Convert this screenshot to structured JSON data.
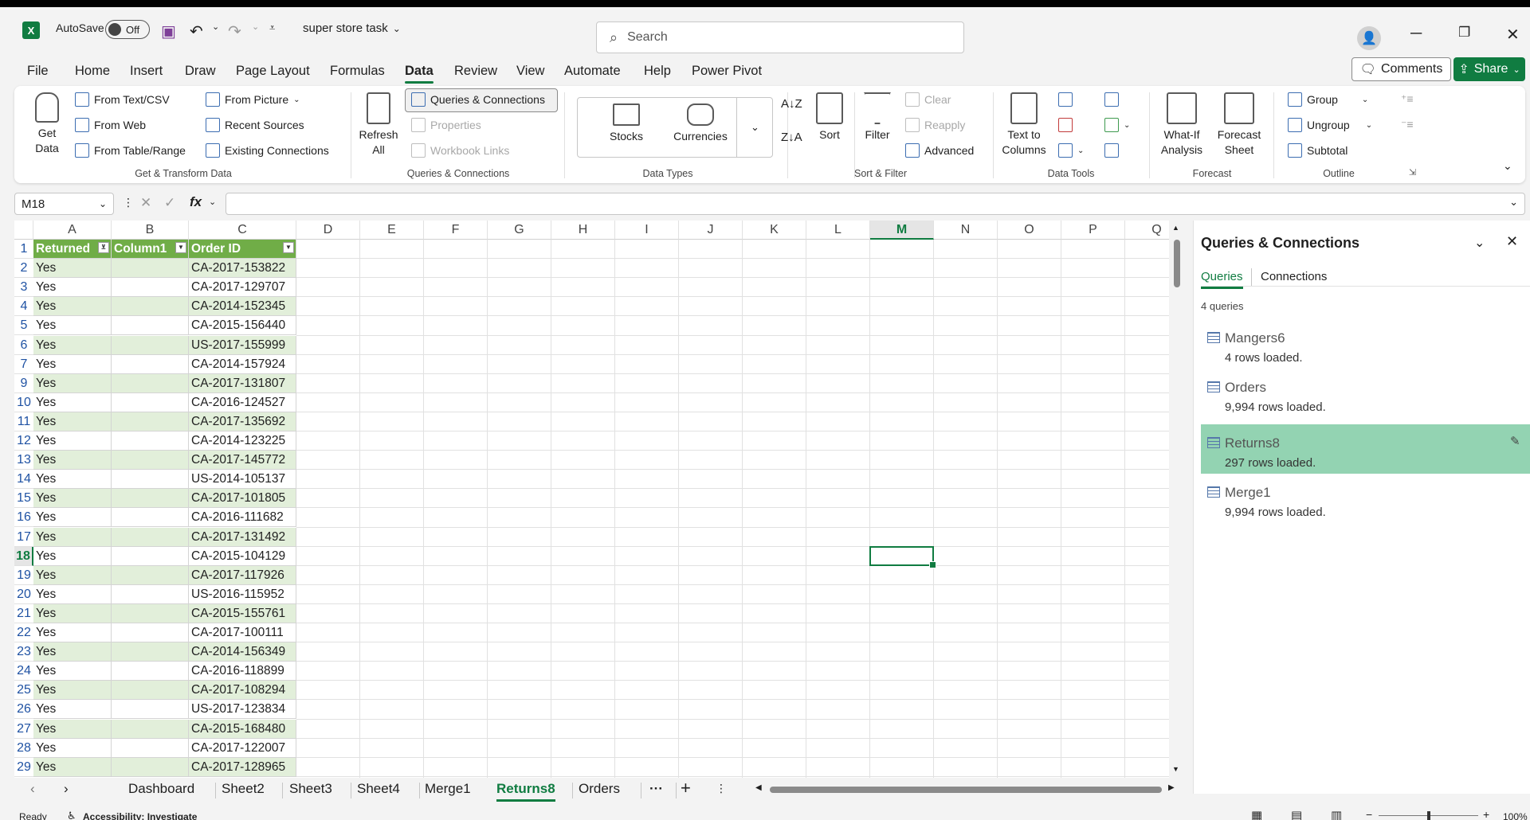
{
  "titlebar": {
    "autosave_label": "AutoSave",
    "autosave_state": "Off",
    "filename": "super store task",
    "search_placeholder": "Search"
  },
  "menu": {
    "tabs": [
      "File",
      "Home",
      "Insert",
      "Draw",
      "Page Layout",
      "Formulas",
      "Data",
      "Review",
      "View",
      "Automate",
      "Help",
      "Power Pivot"
    ],
    "active": "Data",
    "comments": "Comments",
    "share": "Share"
  },
  "ribbon": {
    "get_data": "Get Data",
    "from_text_csv": "From Text/CSV",
    "from_web": "From Web",
    "from_table_range": "From Table/Range",
    "from_picture": "From Picture",
    "recent_sources": "Recent Sources",
    "existing_connections": "Existing Connections",
    "group_get_transform": "Get & Transform Data",
    "refresh_all": "Refresh All",
    "queries_connections": "Queries & Connections",
    "properties": "Properties",
    "workbook_links": "Workbook Links",
    "group_queries": "Queries & Connections",
    "stocks": "Stocks",
    "currencies": "Currencies",
    "group_data_types": "Data Types",
    "sort": "Sort",
    "filter": "Filter",
    "clear": "Clear",
    "reapply": "Reapply",
    "advanced": "Advanced",
    "group_sort_filter": "Sort & Filter",
    "text_to_columns": "Text to Columns",
    "group_data_tools": "Data Tools",
    "what_if": "What-If Analysis",
    "forecast_sheet": "Forecast Sheet",
    "group_forecast": "Forecast",
    "group_btn": "Group",
    "ungroup_btn": "Ungroup",
    "subtotal": "Subtotal",
    "group_outline": "Outline"
  },
  "formula": {
    "namebox": "M18",
    "fx": "fx",
    "value": ""
  },
  "grid": {
    "columns": [
      "A",
      "B",
      "C",
      "D",
      "E",
      "F",
      "G",
      "H",
      "I",
      "J",
      "K",
      "L",
      "M",
      "N",
      "O",
      "P",
      "Q"
    ],
    "headers": [
      "Returned",
      "Column1",
      "Order ID"
    ],
    "row_numbers": [
      "1",
      "2",
      "3",
      "4",
      "5",
      "6",
      "7",
      "9",
      "10",
      "11",
      "12",
      "13",
      "14",
      "15",
      "16",
      "17",
      "18",
      "19",
      "20",
      "21",
      "22",
      "23",
      "24",
      "25",
      "26",
      "27",
      "28",
      "29"
    ],
    "rows": [
      [
        "Yes",
        "",
        "CA-2017-153822"
      ],
      [
        "Yes",
        "",
        "CA-2017-129707"
      ],
      [
        "Yes",
        "",
        "CA-2014-152345"
      ],
      [
        "Yes",
        "",
        "CA-2015-156440"
      ],
      [
        "Yes",
        "",
        "US-2017-155999"
      ],
      [
        "Yes",
        "",
        "CA-2014-157924"
      ],
      [
        "Yes",
        "",
        "CA-2017-131807"
      ],
      [
        "Yes",
        "",
        "CA-2016-124527"
      ],
      [
        "Yes",
        "",
        "CA-2017-135692"
      ],
      [
        "Yes",
        "",
        "CA-2014-123225"
      ],
      [
        "Yes",
        "",
        "CA-2017-145772"
      ],
      [
        "Yes",
        "",
        "US-2014-105137"
      ],
      [
        "Yes",
        "",
        "CA-2017-101805"
      ],
      [
        "Yes",
        "",
        "CA-2016-111682"
      ],
      [
        "Yes",
        "",
        "CA-2017-131492"
      ],
      [
        "Yes",
        "",
        "CA-2015-104129"
      ],
      [
        "Yes",
        "",
        "CA-2017-117926"
      ],
      [
        "Yes",
        "",
        "US-2016-115952"
      ],
      [
        "Yes",
        "",
        "CA-2015-155761"
      ],
      [
        "Yes",
        "",
        "CA-2017-100111"
      ],
      [
        "Yes",
        "",
        "CA-2014-156349"
      ],
      [
        "Yes",
        "",
        "CA-2016-118899"
      ],
      [
        "Yes",
        "",
        "CA-2017-108294"
      ],
      [
        "Yes",
        "",
        "US-2017-123834"
      ],
      [
        "Yes",
        "",
        "CA-2015-168480"
      ],
      [
        "Yes",
        "",
        "CA-2017-122007"
      ],
      [
        "Yes",
        "",
        "CA-2017-128965"
      ]
    ],
    "selected_col": "M",
    "selected_row": "18"
  },
  "sheets": {
    "tabs": [
      "Dashboard",
      "Sheet2",
      "Sheet3",
      "Sheet4",
      "Merge1",
      "Returns8",
      "Orders"
    ],
    "active": "Returns8",
    "more": "···",
    "add": "+"
  },
  "status": {
    "ready": "Ready",
    "accessibility": "Accessibility: Investigate",
    "zoom": "100%"
  },
  "queries_pane": {
    "title": "Queries & Connections",
    "tab_queries": "Queries",
    "tab_connections": "Connections",
    "count": "4 queries",
    "items": [
      {
        "name": "Mangers6",
        "rows": "4 rows loaded."
      },
      {
        "name": "Orders",
        "rows": "9,994 rows loaded."
      },
      {
        "name": "Returns8",
        "rows": "297 rows loaded."
      },
      {
        "name": "Merge1",
        "rows": "9,994 rows loaded."
      }
    ],
    "selected": "Returns8"
  },
  "colors": {
    "accent": "#107c41",
    "table_header": "#70ad47",
    "band": "#e2efda",
    "query_selected": "#93d3b2"
  }
}
